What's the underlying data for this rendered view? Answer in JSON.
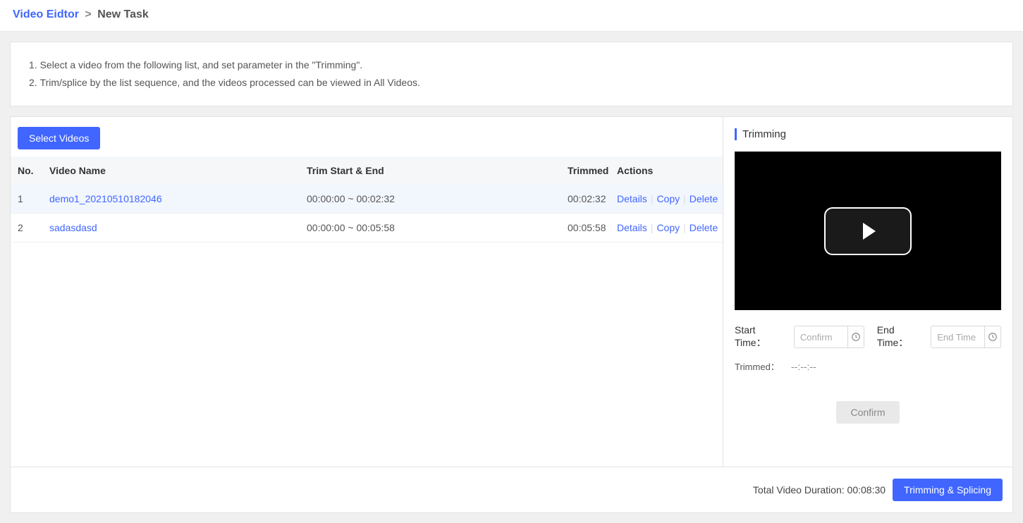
{
  "breadcrumb": {
    "parent": "Video Eidtor",
    "current": "New Task"
  },
  "instructions": [
    "Select a video from the following list, and set parameter in the \"Trimming\".",
    "Trim/splice by the list sequence, and the videos processed can be viewed in All Videos."
  ],
  "buttons": {
    "select_videos": "Select Videos",
    "confirm": "Confirm",
    "trim_splice": "Trimming & Splicing"
  },
  "table": {
    "headers": {
      "no": "No.",
      "name": "Video Name",
      "trim": "Trim Start & End",
      "trimmed": "Trimmed",
      "actions": "Actions"
    },
    "actions": {
      "details": "Details",
      "copy": "Copy",
      "delete": "Delete"
    },
    "rows": [
      {
        "no": "1",
        "name": "demo1_20210510182046",
        "trim": "00:00:00 ~ 00:02:32",
        "trimmed": "00:02:32"
      },
      {
        "no": "2",
        "name": "sadasdasd",
        "trim": "00:00:00 ~ 00:05:58",
        "trimmed": "00:05:58"
      }
    ]
  },
  "trimming": {
    "title": "Trimming",
    "start_label": "Start Time：",
    "end_label": "End Time：",
    "start_placeholder": "Confirm",
    "end_placeholder": "End Time",
    "trimmed_label": "Trimmed：",
    "trimmed_value": "--:--:--"
  },
  "footer": {
    "total_label": "Total Video Duration: ",
    "total_value": "00:08:30"
  }
}
